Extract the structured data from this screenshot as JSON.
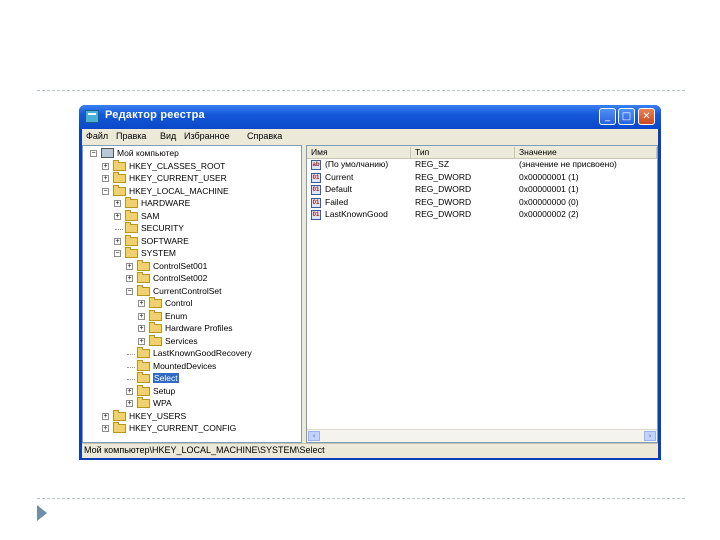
{
  "window": {
    "title": "Редактор реестра",
    "controls": {
      "minimize": "_",
      "maximize": "□",
      "close": "✕"
    }
  },
  "menu": [
    "Файл",
    "Правка",
    "Вид",
    "Избранное",
    "Справка"
  ],
  "tree": [
    {
      "label": "Мой компьютер",
      "depth": 0,
      "expander": "−",
      "icon": "computer-icon"
    },
    {
      "label": "HKEY_CLASSES_ROOT",
      "depth": 1,
      "expander": "+",
      "icon": "folder-icon"
    },
    {
      "label": "HKEY_CURRENT_USER",
      "depth": 1,
      "expander": "+",
      "icon": "folder-icon"
    },
    {
      "label": "HKEY_LOCAL_MACHINE",
      "depth": 1,
      "expander": "−",
      "icon": "folder-icon"
    },
    {
      "label": "HARDWARE",
      "depth": 2,
      "expander": "+",
      "icon": "folder-icon"
    },
    {
      "label": "SAM",
      "depth": 2,
      "expander": "+",
      "icon": "folder-icon"
    },
    {
      "label": "SECURITY",
      "depth": 2,
      "expander": "",
      "icon": "folder-icon"
    },
    {
      "label": "SOFTWARE",
      "depth": 2,
      "expander": "+",
      "icon": "folder-icon"
    },
    {
      "label": "SYSTEM",
      "depth": 2,
      "expander": "−",
      "icon": "folder-icon"
    },
    {
      "label": "ControlSet001",
      "depth": 3,
      "expander": "+",
      "icon": "folder-icon"
    },
    {
      "label": "ControlSet002",
      "depth": 3,
      "expander": "+",
      "icon": "folder-icon"
    },
    {
      "label": "CurrentControlSet",
      "depth": 3,
      "expander": "−",
      "icon": "folder-icon"
    },
    {
      "label": "Control",
      "depth": 4,
      "expander": "+",
      "icon": "folder-icon"
    },
    {
      "label": "Enum",
      "depth": 4,
      "expander": "+",
      "icon": "folder-icon"
    },
    {
      "label": "Hardware Profiles",
      "depth": 4,
      "expander": "+",
      "icon": "folder-icon"
    },
    {
      "label": "Services",
      "depth": 4,
      "expander": "+",
      "icon": "folder-icon"
    },
    {
      "label": "LastKnownGoodRecovery",
      "depth": 3,
      "expander": "",
      "icon": "folder-icon"
    },
    {
      "label": "MountedDevices",
      "depth": 3,
      "expander": "",
      "icon": "folder-icon"
    },
    {
      "label": "Select",
      "depth": 3,
      "expander": "",
      "icon": "folder-icon",
      "selected": true
    },
    {
      "label": "Setup",
      "depth": 3,
      "expander": "+",
      "icon": "folder-icon"
    },
    {
      "label": "WPA",
      "depth": 3,
      "expander": "+",
      "icon": "folder-icon"
    },
    {
      "label": "HKEY_USERS",
      "depth": 1,
      "expander": "+",
      "icon": "folder-icon"
    },
    {
      "label": "HKEY_CURRENT_CONFIG",
      "depth": 1,
      "expander": "+",
      "icon": "folder-icon"
    }
  ],
  "list": {
    "columns": [
      "Имя",
      "Тип",
      "Значение"
    ],
    "rows": [
      {
        "icon": "string-value-icon",
        "icon_text": "ab",
        "name": "(По умолчанию)",
        "type": "REG_SZ",
        "value": "(значение не присвоено)"
      },
      {
        "icon": "dword-value-icon",
        "icon_text": "01",
        "name": "Current",
        "type": "REG_DWORD",
        "value": "0x00000001 (1)"
      },
      {
        "icon": "dword-value-icon",
        "icon_text": "01",
        "name": "Default",
        "type": "REG_DWORD",
        "value": "0x00000001 (1)"
      },
      {
        "icon": "dword-value-icon",
        "icon_text": "01",
        "name": "Failed",
        "type": "REG_DWORD",
        "value": "0x00000000 (0)"
      },
      {
        "icon": "dword-value-icon",
        "icon_text": "01",
        "name": "LastKnownGood",
        "type": "REG_DWORD",
        "value": "0x00000002 (2)"
      }
    ],
    "scroll_left": "‹",
    "scroll_right": "›"
  },
  "status": "Мой компьютер\\HKEY_LOCAL_MACHINE\\SYSTEM\\Select",
  "colors": {
    "titlebar": "#0a48c8",
    "selection": "#316ac5",
    "folder": "#f0d070",
    "bullet": "#6f8ea8"
  }
}
